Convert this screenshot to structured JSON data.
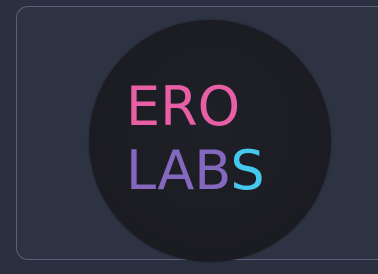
{
  "logo": {
    "line1": "ERO",
    "line2_main": "LAB",
    "line2_accent": "S",
    "colors": {
      "pink": "#e85fa5",
      "purple": "#8468bf",
      "cyan": "#46c8ee",
      "circle": "#1c1d23",
      "background": "#2a3040",
      "border": "#59607a"
    }
  }
}
